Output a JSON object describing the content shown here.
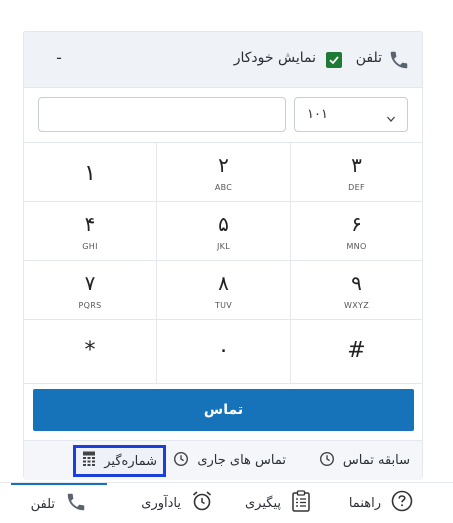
{
  "header": {
    "title": "تلفن",
    "auto_display_label": "نمایش خودکار",
    "auto_display_checked": true,
    "minimize_label": "-"
  },
  "dial": {
    "number_value": "",
    "line_value": "۱۰۱"
  },
  "keypad": [
    {
      "digit": "۱",
      "letters": ""
    },
    {
      "digit": "۲",
      "letters": "ABC"
    },
    {
      "digit": "۳",
      "letters": "DEF"
    },
    {
      "digit": "۴",
      "letters": "GHI"
    },
    {
      "digit": "۵",
      "letters": "JKL"
    },
    {
      "digit": "۶",
      "letters": "MNO"
    },
    {
      "digit": "۷",
      "letters": "PQRS"
    },
    {
      "digit": "۸",
      "letters": "TUV"
    },
    {
      "digit": "۹",
      "letters": "WXYZ"
    },
    {
      "digit": "*",
      "letters": ""
    },
    {
      "digit": "۰",
      "letters": ""
    },
    {
      "digit": "#",
      "letters": ""
    }
  ],
  "call_button": "تماس",
  "subtabs": {
    "history": "سابقه تماس",
    "current": "تماس های جاری",
    "dialer": "شماره‌گیر"
  },
  "bottom_nav": {
    "help": "راهنما",
    "tracking": "پیگیری",
    "reminder": "یادآوری",
    "phone": "تلفن"
  },
  "colors": {
    "accent": "#1673b9",
    "checkbox": "#1e7a35",
    "highlight_border": "#1b3fdb"
  }
}
